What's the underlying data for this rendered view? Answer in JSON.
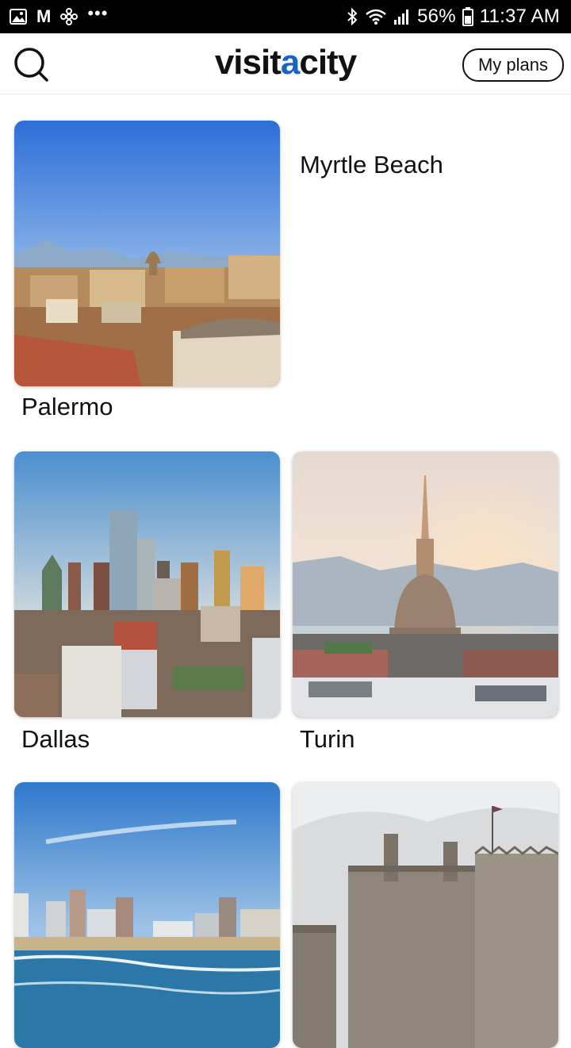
{
  "status_bar": {
    "mail_icon_letter": "M",
    "dots": "•••",
    "battery_percent": "56%",
    "time": "11:37 AM"
  },
  "header": {
    "logo_part1": "visit",
    "logo_accent": "a",
    "logo_part2": "city",
    "my_plans_label": "My plans"
  },
  "cities": [
    {
      "name": "Palermo",
      "has_image": true
    },
    {
      "name": "Myrtle Beach",
      "has_image": false
    },
    {
      "name": "Dallas",
      "has_image": true
    },
    {
      "name": "Turin",
      "has_image": true
    },
    {
      "name": "",
      "has_image": true
    },
    {
      "name": "",
      "has_image": true
    }
  ],
  "colors": {
    "accent": "#1565c0",
    "status_bar": "#000000",
    "text": "#111111"
  }
}
